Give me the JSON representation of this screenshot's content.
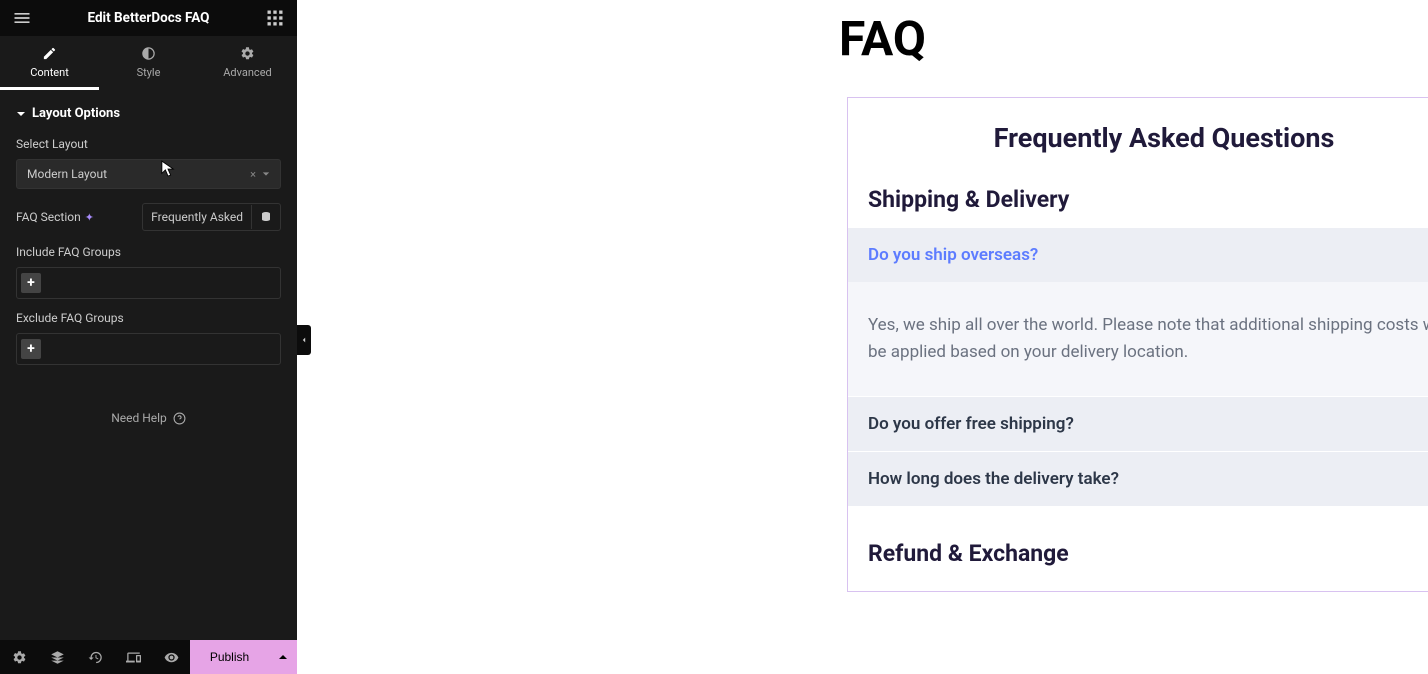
{
  "sidebar": {
    "title": "Edit BetterDocs FAQ",
    "tabs": {
      "content": "Content",
      "style": "Style",
      "advanced": "Advanced"
    },
    "section_header": "Layout Options",
    "select_layout_label": "Select Layout",
    "select_layout_value": "Modern Layout",
    "faq_section_label": "FAQ Section",
    "faq_section_value": "Frequently Asked",
    "include_groups_label": "Include FAQ Groups",
    "exclude_groups_label": "Exclude FAQ Groups",
    "need_help": "Need Help"
  },
  "footer": {
    "publish": "Publish"
  },
  "canvas": {
    "page_title": "FAQ",
    "widget_title": "Frequently Asked Questions",
    "groups": [
      {
        "title": "Shipping & Delivery",
        "items": [
          {
            "q": "Do you ship overseas?",
            "a": "Yes, we ship all over the world. Please note that additional shipping costs will be applied based on your delivery location.",
            "open": true
          },
          {
            "q": "Do you offer free shipping?",
            "open": false
          },
          {
            "q": "How long does the delivery take?",
            "open": false
          }
        ]
      },
      {
        "title": "Refund & Exchange",
        "items": []
      }
    ]
  }
}
